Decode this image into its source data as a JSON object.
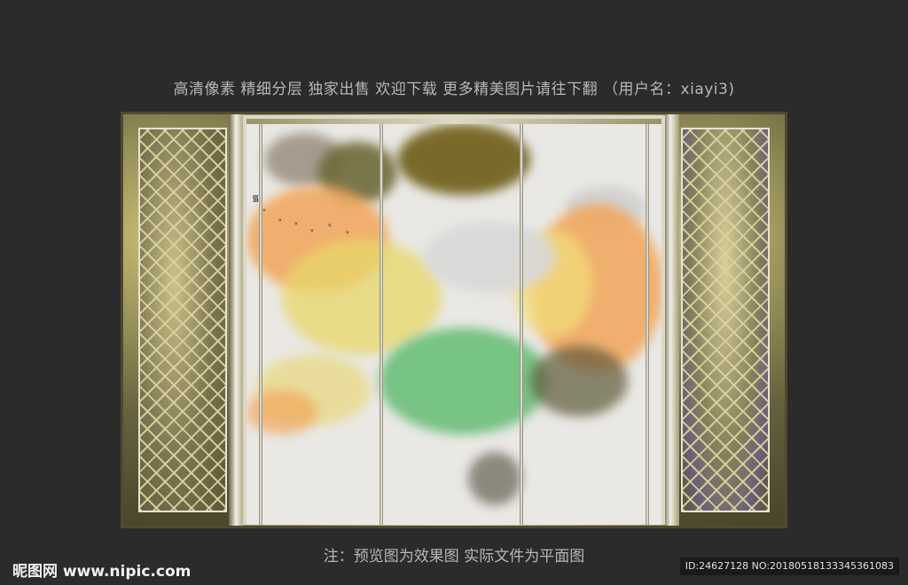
{
  "header": {
    "text": "高清像素 精细分层 独家出售 欢迎下载 更多精美图片请往下翻 （用户名：xiayi3)"
  },
  "caption": {
    "text": "注：预览图为效果图 实际文件为平面图"
  },
  "watermark": {
    "text": "昵图网 www.nipic.com"
  },
  "image_id": {
    "text": "ID:24627128 NO:20180518133345361083"
  },
  "colors": {
    "background": "#2b2b2b",
    "text": "#b7b7b7",
    "frame_gold": "#9c9470",
    "ink_orange": "#f2a65a",
    "ink_green": "#6bbf7a",
    "ink_yellow": "#e8d86a",
    "ink_brown": "#7a6a2a"
  }
}
